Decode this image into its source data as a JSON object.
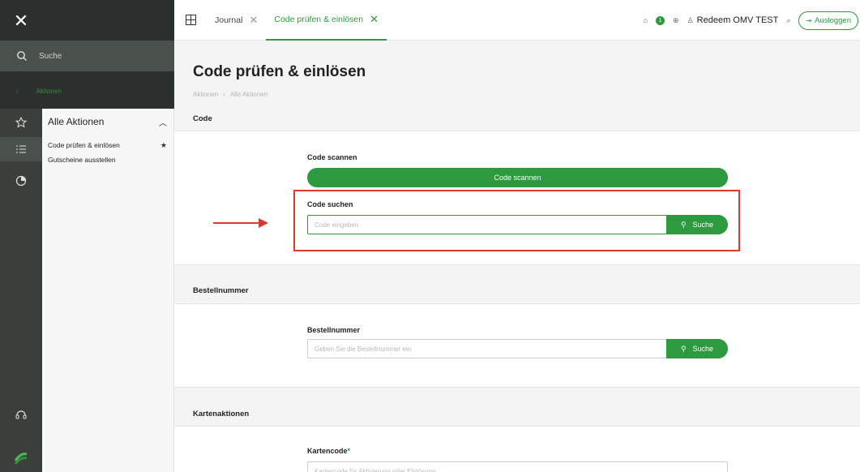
{
  "sidebar": {
    "search_label": "Suche",
    "back_label": "Aktionen",
    "group_title": "Alle Aktionen",
    "items": [
      {
        "label": "Code prüfen & einlösen",
        "starred": true
      },
      {
        "label": "Gutscheine ausstellen",
        "starred": false
      }
    ]
  },
  "topbar": {
    "tabs": [
      {
        "label": "Journal",
        "active": false
      },
      {
        "label": "Code prüfen & einlösen",
        "active": true
      }
    ],
    "notification_count": "1",
    "user_name": "Redeem OMV TEST",
    "logout_label": "Ausloggen"
  },
  "main": {
    "title": "Code prüfen & einlösen",
    "breadcrumb": [
      "Aktionen",
      "Alle Aktionen"
    ],
    "sections": {
      "code": {
        "label": "Code",
        "scan_label": "Code scannen",
        "scan_button": "Code scannen",
        "search_label": "Code suchen",
        "search_placeholder": "Code eingeben",
        "search_button": "Suche"
      },
      "order": {
        "label": "Bestellnummer",
        "field_label": "Bestellnummer",
        "placeholder": "Geben Sie die Bestellnummer ein",
        "search_button": "Suche"
      },
      "card": {
        "label": "Kartenaktionen",
        "field_label": "Kartencode",
        "required_mark": "*",
        "placeholder": "Kartencode für Aktivierung oder Einlösung"
      }
    }
  },
  "colors": {
    "accent": "#2e9a3f",
    "highlight": "#d93a2b",
    "rail": "#3a3f3c"
  }
}
